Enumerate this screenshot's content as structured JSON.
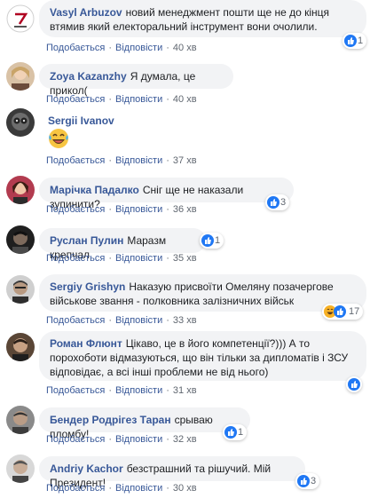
{
  "actions": {
    "like_label": "Подобається",
    "reply_label": "Відповісти",
    "separator": "·"
  },
  "colors": {
    "author": "#385898",
    "bubble": "#f2f3f5",
    "like_blue": "#2078f4",
    "haha_yellow": "#f7b125"
  },
  "comments": [
    {
      "author": "Vasyl Arbuzov",
      "text": "новий менеджмент пошти ще не до кінця втямив який електоральний інструмент вони очолили.",
      "time": "40 хв",
      "reactions": {
        "icons": [
          "like-icon"
        ],
        "count": "1"
      }
    },
    {
      "author": "Zoya Kazanzhy",
      "text": "Я думала, це прикол(",
      "time": "40 хв",
      "reactions": null
    },
    {
      "author": "Sergii Ivanov",
      "text": "",
      "sticker": "laughing-emoji",
      "time": "37 хв",
      "reactions": null
    },
    {
      "author": "Марічка Падалко",
      "text": "Сніг ще не наказали зупинити?",
      "time": "36 хв",
      "reactions": {
        "icons": [
          "like-icon"
        ],
        "count": "3"
      }
    },
    {
      "author": "Руслан Пулин",
      "text": "Маразм крепчал",
      "time": "35 хв",
      "reactions": {
        "icons": [
          "like-icon"
        ],
        "count": "1"
      }
    },
    {
      "author": "Sergiy Grishyn",
      "text": "Наказую присвоїти Омеляну позачергове військове звання - полковника залізничних військ",
      "time": "33 хв",
      "reactions": {
        "icons": [
          "haha-icon",
          "like-icon"
        ],
        "count": "17"
      }
    },
    {
      "author": "Роман Флюнт",
      "text": "Цікаво, це в його компетенції?))) А то порохоботи відмазуються, що він тільки за дипломатів і ЗСУ відповідає, а всі інші проблеми не від нього)",
      "time": "31 хв",
      "reactions": {
        "icons": [
          "like-icon"
        ],
        "count": ""
      }
    },
    {
      "author": "Бендер Родрігез Таран",
      "text": "срываю пломбу!",
      "time": "32 хв",
      "reactions": {
        "icons": [
          "like-icon"
        ],
        "count": "1"
      }
    },
    {
      "author": "Andriy Kachor",
      "text": "безстрашний та рішучий. Мій Президент!",
      "time": "30 хв",
      "reactions": {
        "icons": [
          "like-icon"
        ],
        "count": "3"
      }
    }
  ]
}
